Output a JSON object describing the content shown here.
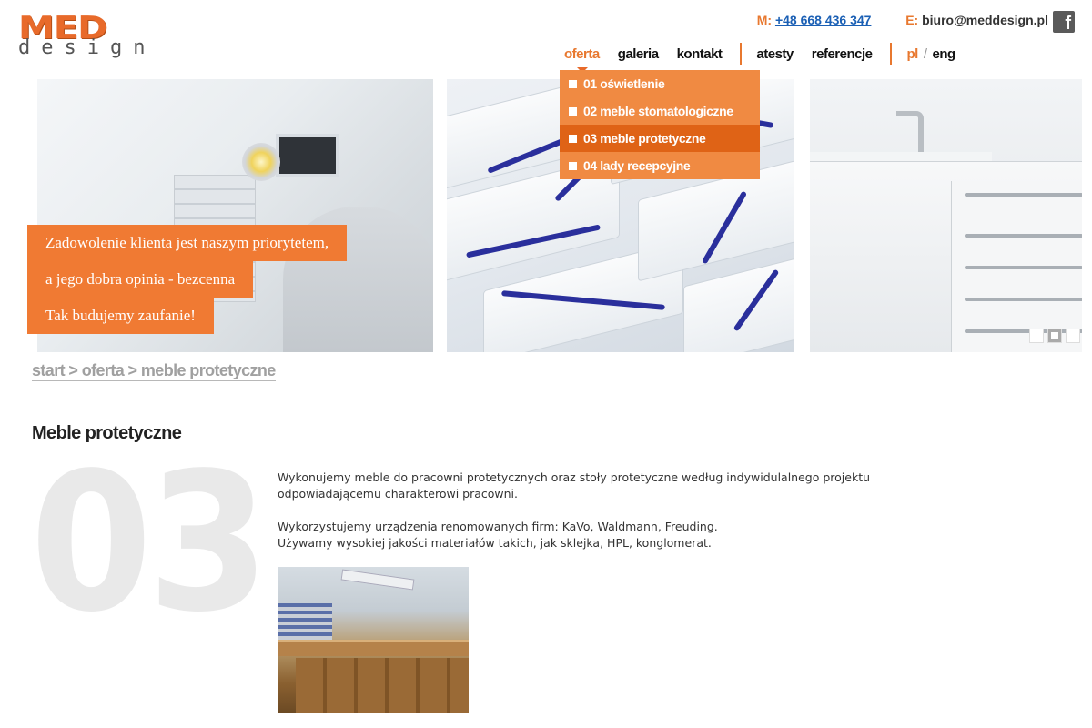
{
  "logo": {
    "top": "MED",
    "bottom": "design"
  },
  "contact": {
    "m_label": "M:",
    "phone": "+48 668 436 347",
    "e_label": "E:",
    "email": "biuro@meddesign.pl",
    "facebook_glyph": "f"
  },
  "nav": {
    "items": [
      "oferta",
      "galeria",
      "kontakt",
      "atesty",
      "referencje"
    ],
    "lang_pl": "pl",
    "lang_sep": "/",
    "lang_eng": "eng"
  },
  "dropdown": {
    "items": [
      "01 oświetlenie",
      "02 meble stomatologiczne",
      "03 meble protetyczne",
      "04 lady recepcyjne"
    ],
    "active_index": 2
  },
  "slogan": {
    "line1": "Zadowolenie klienta jest naszym priorytetem,",
    "line2": "a jego dobra opinia - bezcenna",
    "line3": "Tak budujemy zaufanie!"
  },
  "slider": {
    "dots": 3,
    "active_index": 1
  },
  "breadcrumb": {
    "start": "start",
    "sep1": " > ",
    "oferta": "oferta",
    "sep2": " > ",
    "current": "meble protetyczne"
  },
  "content": {
    "title": "Meble protetyczne",
    "number": "03",
    "para1": "Wykonujemy meble do pracowni protetycznych oraz stoły protetyczne według indywidulalnego projektu odpowiadającemu charakterowi pracowni.",
    "para2a": "Wykorzystujemy urządzenia renomowanych firm: KaVo, Waldmann, Freuding.",
    "para2b": "Używamy wysokiej jakości materiałów takich, jak sklejka, HPL, konglomerat."
  },
  "colors": {
    "accent": "#f07a33",
    "accent_dark": "#df6316",
    "link": "#1a5fb4"
  }
}
